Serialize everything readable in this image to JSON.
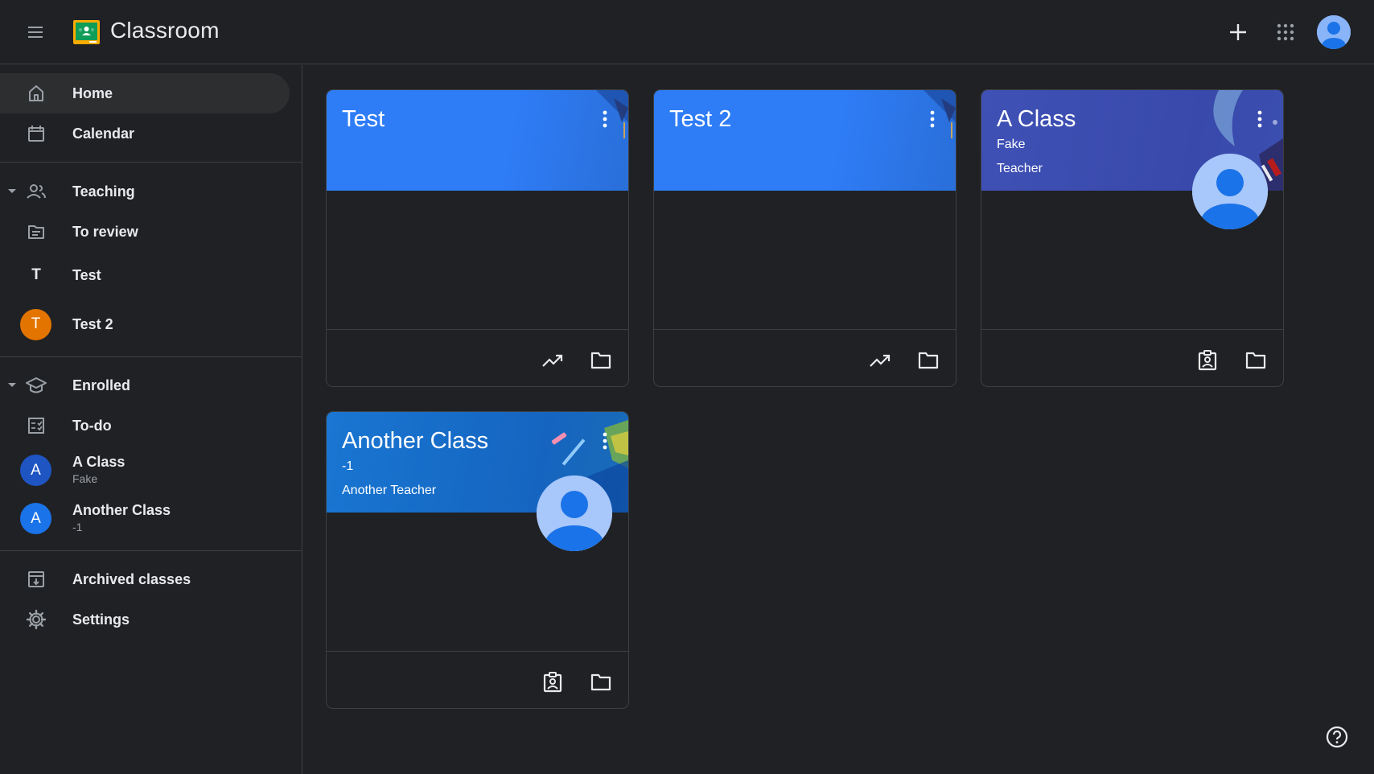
{
  "app": {
    "title": "Classroom"
  },
  "topbar": {
    "menu_icon": "hamburger-menu-icon",
    "add_icon": "plus-icon",
    "apps_icon": "apps-grid-icon",
    "avatar_icon": "account-avatar-icon"
  },
  "sidebar": {
    "home": "Home",
    "calendar": "Calendar",
    "teaching": "Teaching",
    "to_review": "To review",
    "teaching_classes": [
      {
        "initial": "T",
        "name": "Test"
      },
      {
        "initial": "T",
        "name": "Test 2",
        "color": "#e37400"
      }
    ],
    "enrolled": "Enrolled",
    "todo": "To-do",
    "enrolled_classes": [
      {
        "initial": "A",
        "name": "A Class",
        "section": "Fake",
        "color": "#1e55c2"
      },
      {
        "initial": "A",
        "name": "Another Class",
        "section": "-1",
        "color": "#1a73e8"
      }
    ],
    "archived": "Archived classes",
    "settings": "Settings"
  },
  "cards": [
    {
      "title": "Test",
      "section": "",
      "teacher": "",
      "header_color": "#2e7cf6",
      "footer_icons": [
        "trending-up-icon",
        "folder-icon"
      ]
    },
    {
      "title": "Test 2",
      "section": "",
      "teacher": "",
      "header_color": "#2e7cf6",
      "footer_icons": [
        "trending-up-icon",
        "folder-icon"
      ]
    },
    {
      "title": "A Class",
      "section": "Fake",
      "teacher": "Teacher",
      "header_color": "#3f51b5",
      "footer_icons": [
        "assignment-ind-icon",
        "folder-icon"
      ]
    },
    {
      "title": "Another Class",
      "section": "-1",
      "teacher": "Another Teacher",
      "header_color": "#1976d2",
      "footer_icons": [
        "assignment-ind-icon",
        "folder-icon"
      ]
    }
  ],
  "colors": {
    "background": "#202124",
    "accent_blue": "#2e7cf6",
    "accent_indigo": "#3f51b5",
    "accent_orange": "#e37400",
    "text_primary": "#e8eaed",
    "text_secondary": "#9aa0a6"
  },
  "help_icon": "help-circle-icon"
}
